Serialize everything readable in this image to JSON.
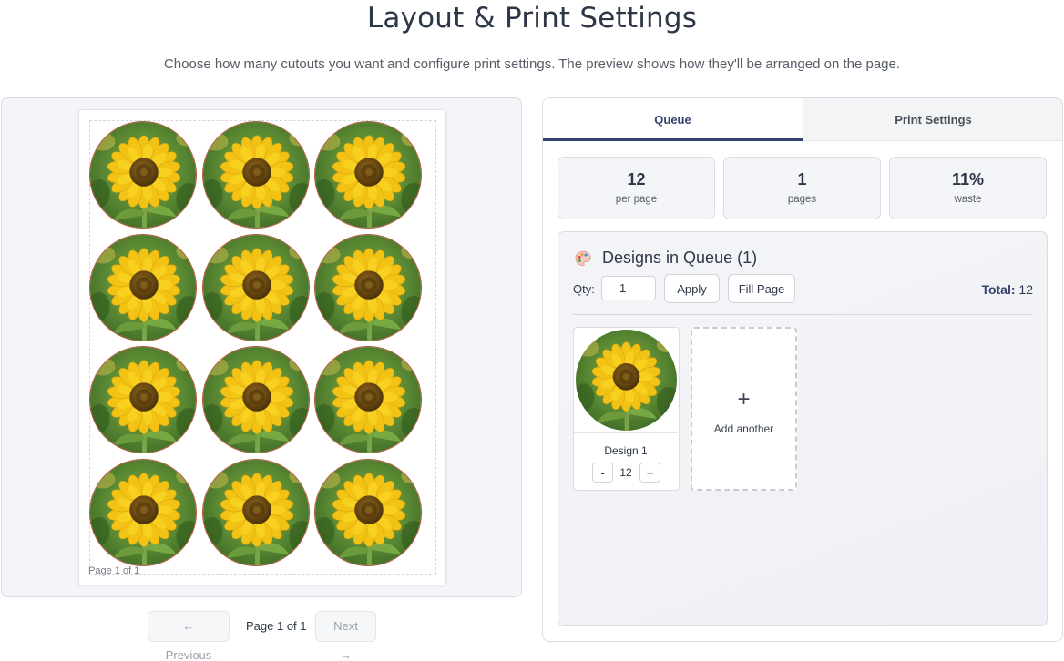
{
  "page": {
    "title": "Layout & Print Settings",
    "subtitle": "Choose how many cutouts you want and configure print settings. The preview shows how they'll be arranged on the page."
  },
  "preview": {
    "page_mark": "Page 1 of 1",
    "cutout_count": 12,
    "cutout_image": "sunflower-image"
  },
  "pager": {
    "prev_label": "← Previous",
    "page_label": "Page 1 of 1",
    "next_label": "Next →"
  },
  "tabs": [
    {
      "label": "Queue",
      "active": true
    },
    {
      "label": "Print Settings",
      "active": false
    }
  ],
  "stats": [
    {
      "value": "12",
      "label": "per page"
    },
    {
      "value": "1",
      "label": "pages"
    },
    {
      "value": "11%",
      "label": "waste"
    }
  ],
  "queue": {
    "heading_icon": "palette-icon",
    "heading": "Designs in Queue (1)",
    "qty_label": "Qty:",
    "qty_value": "1",
    "apply_label": "Apply",
    "fill_label": "Fill Page",
    "total_label": "Total:",
    "total_value": "12",
    "designs": [
      {
        "name": "Design 1",
        "quantity": "12",
        "image": "sunflower-image"
      }
    ],
    "stepper": {
      "minus": "-",
      "plus": "+"
    },
    "add_card": {
      "icon": "+",
      "label": "Add another"
    }
  },
  "colors": {
    "accent": "#34456e",
    "cutout_border": "#b5583d"
  }
}
